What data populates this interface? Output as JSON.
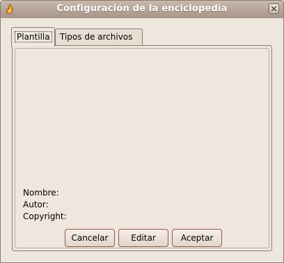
{
  "window": {
    "title": "Configuración de la enciclopedia",
    "icons": {
      "app": "app-flame-icon",
      "close": "close-icon"
    }
  },
  "tabs": [
    {
      "label": "Plantilla",
      "active": true
    },
    {
      "label": "Tipos de archivos",
      "active": false
    }
  ],
  "template_info": {
    "name_label": "Nombre:",
    "author_label": "Autor:",
    "copyright_label": "Copyright:"
  },
  "buttons": {
    "cancel": "Cancelar",
    "edit": "Editar",
    "accept": "Aceptar"
  },
  "colors": {
    "background": "#efe6de",
    "titlebar": "#b4a296",
    "button_border": "#8c5a48"
  }
}
